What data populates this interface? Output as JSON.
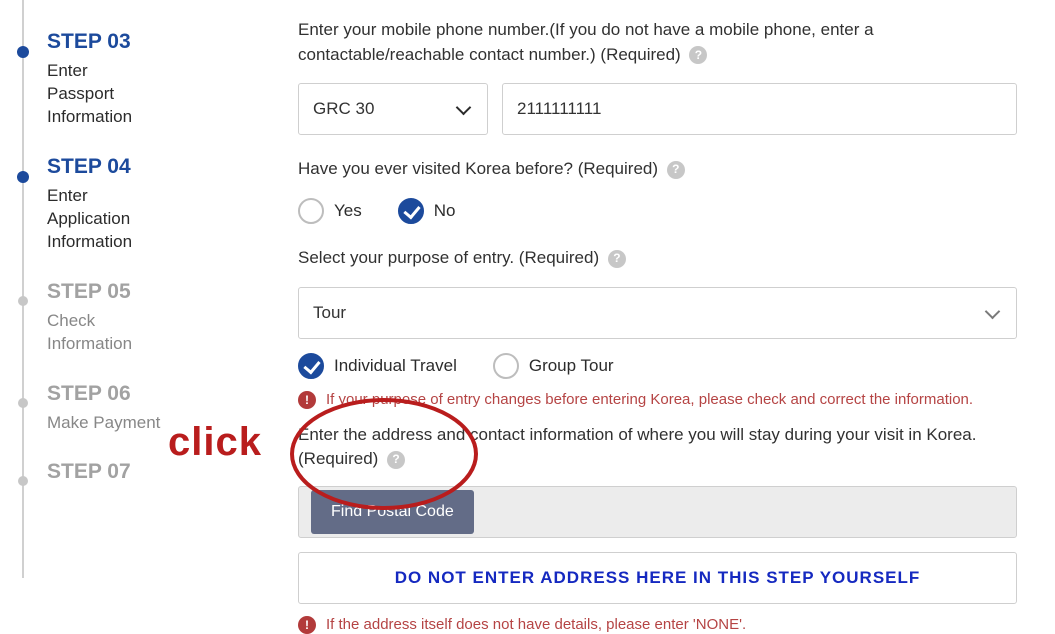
{
  "steps": [
    {
      "num": "STEP 03",
      "title": "Enter\nPassport\nInformation",
      "active": true
    },
    {
      "num": "STEP 04",
      "title": "Enter\nApplication\nInformation",
      "active": true
    },
    {
      "num": "STEP 05",
      "title": "Check\nInformation",
      "active": false
    },
    {
      "num": "STEP 06",
      "title": "Make Payment",
      "active": false
    },
    {
      "num": "STEP 07",
      "title": "",
      "active": false
    }
  ],
  "phone": {
    "label": "Enter your mobile phone number.(If you do not have a mobile phone, enter a contactable/reachable contact number.) (Required)",
    "country": "GRC 30",
    "number": "2111111111"
  },
  "visited": {
    "label": "Have you ever visited Korea before? (Required)",
    "yes": "Yes",
    "no": "No",
    "value": "No"
  },
  "purpose": {
    "label": "Select your purpose of entry. (Required)",
    "value": "Tour",
    "optA": "Individual Travel",
    "optB": "Group Tour",
    "selected": "Individual Travel",
    "warn": "If your purpose of entry changes before entering Korea, please check and correct the information."
  },
  "address": {
    "label": "Enter the address and contact information of where you will stay during your visit in Korea. (Required)",
    "findBtn": "Find Postal Code",
    "placeholderOverlay": "DO  NOT  ENTER  ADDRESS  HERE  IN  THIS  STEP  YOURSELF",
    "warn": "If the address itself does not have details, please enter 'NONE'."
  },
  "annotation": {
    "text": "click"
  }
}
